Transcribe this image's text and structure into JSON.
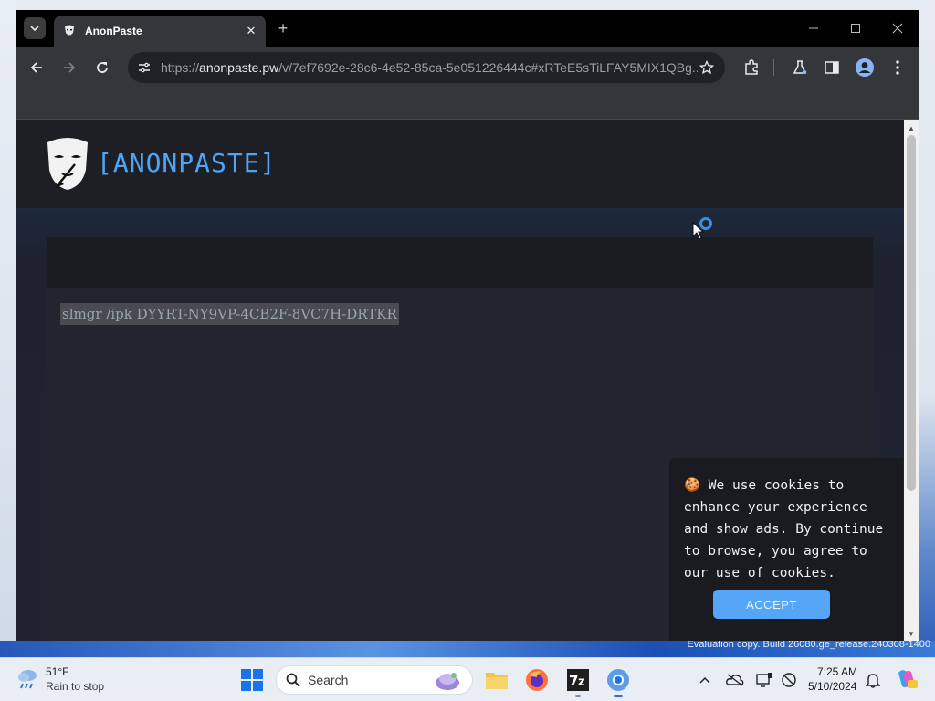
{
  "browser": {
    "tab_title": "AnonPaste",
    "tab_close": "✕",
    "new_tab": "+",
    "url_prefix": "https://",
    "url_host": "anonpaste.pw",
    "url_path": "/v/7ef7692e-28c6-4e52-85ca-5e051226444c#xRTeE5sTiLFAY5MIX1QBg..."
  },
  "page": {
    "brand": "[ANONPASTE]",
    "paste_text": "slmgr /ipk DYYRT-NY9VP-4CB2F-8VC7H-DRTKR"
  },
  "cookie": {
    "message": "🍪 We use cookies to enhance your experience and show ads. By continue to browse, you agree to our use of cookies.",
    "accept_label": "ACCEPT"
  },
  "desktop": {
    "watermark": "Evaluation copy. Build 26080.ge_release.240308-1400"
  },
  "taskbar": {
    "temperature": "51°F",
    "weather": "Rain to stop",
    "search_label": "Search",
    "time": "7:25 AM",
    "date": "5/10/2024"
  },
  "colors": {
    "brand": "#4ea4f6",
    "accept_button": "#56a6f7",
    "page_bg": "#1f2029"
  }
}
